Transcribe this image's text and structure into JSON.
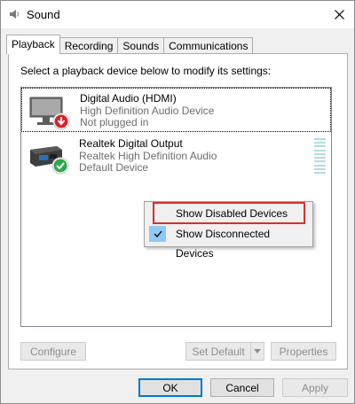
{
  "window": {
    "title": "Sound",
    "title_icon": "speaker-icon",
    "close_icon": "close-icon"
  },
  "tabs": [
    {
      "label": "Playback",
      "active": true
    },
    {
      "label": "Recording",
      "active": false
    },
    {
      "label": "Sounds",
      "active": false
    },
    {
      "label": "Communications",
      "active": false
    }
  ],
  "playback": {
    "instruction": "Select a playback device below to modify its settings:",
    "devices": [
      {
        "name": "Digital Audio (HDMI)",
        "driver": "High Definition Audio Device",
        "status": "Not plugged in",
        "icon": "monitor-icon",
        "badge": "down-arrow-badge-icon"
      },
      {
        "name": "Realtek Digital Output",
        "driver": "Realtek High Definition Audio",
        "status": "Default Device",
        "icon": "digital-output-icon",
        "badge": "checkmark-badge-icon"
      }
    ],
    "buttons": {
      "configure": "Configure",
      "set_default": "Set Default",
      "properties": "Properties"
    }
  },
  "context_menu": {
    "items": [
      {
        "label": "Show Disabled Devices",
        "checked": false
      },
      {
        "label": "Show Disconnected Devices",
        "checked": true
      }
    ]
  },
  "footer": {
    "ok": "OK",
    "cancel": "Cancel",
    "apply": "Apply"
  },
  "colors": {
    "accent": "#0078d7",
    "highlight_box": "#d9302e",
    "badge_red": "#d4232b",
    "badge_green": "#2fa84f"
  }
}
